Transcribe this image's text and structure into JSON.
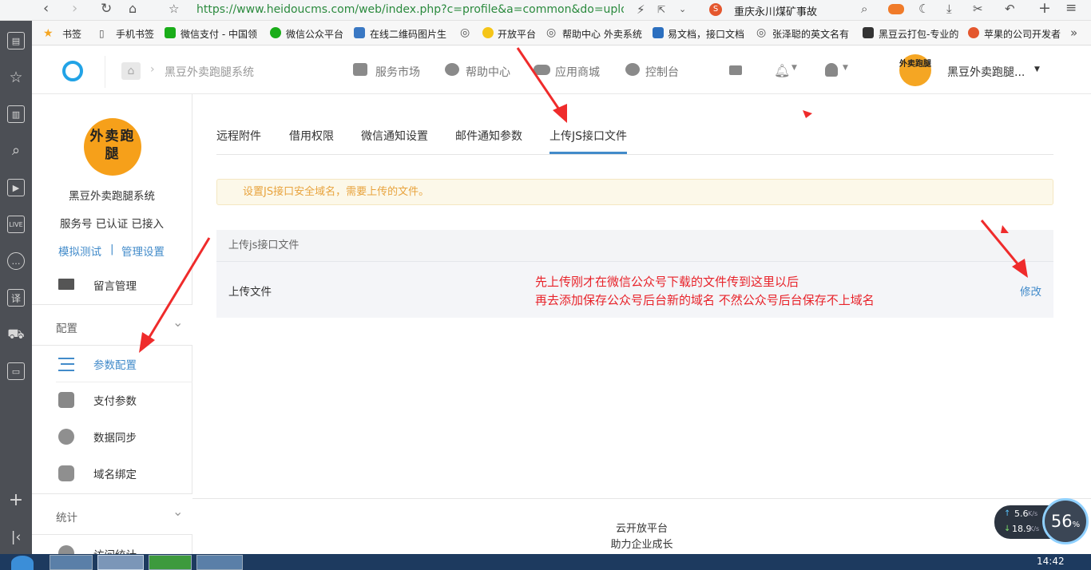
{
  "browser": {
    "url": "https://www.heidoucms.com/web/index.php?c=profile&a=common&do=uploa",
    "search_text": "重庆永川煤矿事故",
    "bookmarks": [
      "书签",
      "手机书签",
      "微信支付 - 中国领",
      "微信公众平台",
      "在线二维码图片生",
      "开放平台",
      "帮助中心 外卖系统",
      "易文档，接口文档",
      "张泽聪的英文名有",
      "黑豆云打包-专业的",
      "苹果的公司开发者"
    ]
  },
  "topnav": {
    "breadcrumb": "黑豆外卖跑腿系统",
    "items": [
      "服务市场",
      "帮助中心",
      "应用商城",
      "控制台"
    ],
    "account_name": "黑豆外卖跑腿..."
  },
  "sidebar": {
    "logo_text": "外卖跑腿",
    "site_name": "黑豆外卖跑腿系统",
    "account_status": "服务号 已认证 已接入",
    "link_test": "模拟测试",
    "link_separator": "|",
    "link_manage": "管理设置",
    "message_item": "留言管理",
    "section_config": "配置",
    "config_items": [
      "参数配置",
      "支付参数",
      "数据同步",
      "域名绑定"
    ],
    "section_stats": "统计",
    "stats_item_partial": "访问统计"
  },
  "main": {
    "tabs": [
      "远程附件",
      "借用权限",
      "微信通知设置",
      "邮件通知参数",
      "上传JS接口文件"
    ],
    "notice": "设置JS接口安全域名，需要上传的文件。",
    "panel_title": "上传js接口文件",
    "row_label": "上传文件",
    "annotation_line1": "先上传刚才在微信公众号下载的文件传到这里以后",
    "annotation_line2": "再去添加保存公众号后台新的域名 不然公众号后台保存不上域名",
    "edit_link": "修改"
  },
  "footer": {
    "line1": "云开放平台",
    "line2": "助力企业成长"
  },
  "system": {
    "clock": "14:42",
    "upload_speed": "5.6",
    "download_speed": "18.9",
    "speed_unit": "K/s",
    "gauge_value": "56",
    "gauge_unit": "%"
  },
  "colors": {
    "accent": "#428bca",
    "annotation": "#e8232a",
    "notice_text": "#e8a33d",
    "notice_bg": "#fcf8e9"
  }
}
